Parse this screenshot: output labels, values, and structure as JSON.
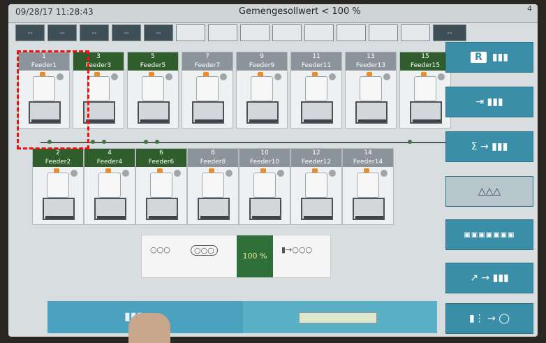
{
  "header": {
    "datetime": "09/28/17 11:28:43",
    "title": "Gemengesollwert < 100 %",
    "page_number": "4"
  },
  "nav": {
    "buttons": [
      "--",
      "--",
      "--",
      "--",
      "--",
      "",
      "",
      "",
      "",
      "",
      "",
      "",
      "",
      "",
      "--"
    ]
  },
  "feeders_top": [
    {
      "num": "1",
      "name": "Feeder1",
      "state": "inactive"
    },
    {
      "num": "3",
      "name": "Feeder3",
      "state": "active"
    },
    {
      "num": "5",
      "name": "Feeder5",
      "state": "active"
    },
    {
      "num": "7",
      "name": "Feeder7",
      "state": "inactive"
    },
    {
      "num": "9",
      "name": "Feeder9",
      "state": "inactive"
    },
    {
      "num": "11",
      "name": "Feeder11",
      "state": "inactive"
    },
    {
      "num": "13",
      "name": "Feeder13",
      "state": "inactive"
    },
    {
      "num": "15",
      "name": "Feeder15",
      "state": "active"
    }
  ],
  "feeders_bottom": [
    {
      "num": "2",
      "name": "Feeder2",
      "state": "active"
    },
    {
      "num": "4",
      "name": "Feeder4",
      "state": "active"
    },
    {
      "num": "6",
      "name": "Feeder6",
      "state": "active"
    },
    {
      "num": "8",
      "name": "Feeder8",
      "state": "inactive"
    },
    {
      "num": "10",
      "name": "Feeder10",
      "state": "inactive"
    },
    {
      "num": "12",
      "name": "Feeder12",
      "state": "inactive"
    },
    {
      "num": "14",
      "name": "Feeder14",
      "state": "inactive"
    }
  ],
  "mode": {
    "selected_label": "100 %"
  },
  "right_panel": {
    "btn_r": "R"
  },
  "colors": {
    "active_green": "#2f5e2c",
    "inactive_gray": "#8b949a",
    "accent_blue": "#3b8ea8"
  }
}
